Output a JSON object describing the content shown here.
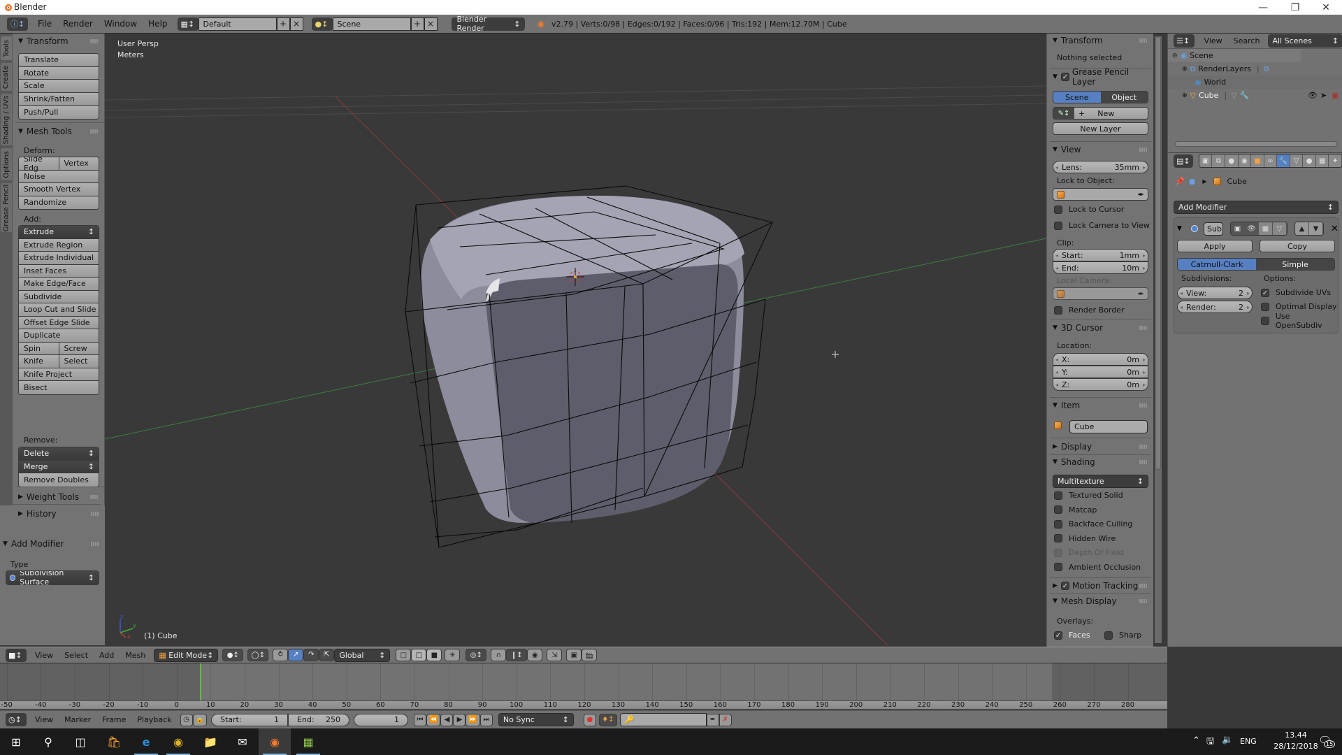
{
  "window": {
    "title": "Blender",
    "controls": [
      "minimize",
      "maximize",
      "close"
    ]
  },
  "info_header": {
    "menus": [
      "File",
      "Render",
      "Window",
      "Help"
    ],
    "screen_layout": "Default",
    "scene": "Scene",
    "render_engine": "Blender Render",
    "stats": "v2.79 | Verts:0/98 | Edges:0/192 | Faces:0/96 | Tris:192 | Mem:12.70M | Cube"
  },
  "tool_tabs": [
    "Tools",
    "Create",
    "Shading / UVs",
    "Options",
    "Grease Pencil"
  ],
  "toolshelf": {
    "transform": {
      "title": "Transform",
      "buttons": [
        "Translate",
        "Rotate",
        "Scale",
        "Shrink/Fatten",
        "Push/Pull"
      ]
    },
    "mesh_tools": {
      "title": "Mesh Tools",
      "deform_label": "Deform:",
      "deform_row": [
        "Slide Edg",
        "Vertex"
      ],
      "deform_buttons": [
        "Noise",
        "Smooth Vertex",
        "Randomize"
      ],
      "add_label": "Add:",
      "extrude_dropdown": "Extrude",
      "add_buttons": [
        "Extrude Region",
        "Extrude Individual",
        "Inset Faces",
        "Make Edge/Face",
        "Subdivide",
        "Loop Cut and Slide",
        "Offset Edge Slide",
        "Duplicate"
      ],
      "spin_row": [
        "Spin",
        "Screw"
      ],
      "knife_row": [
        "Knife",
        "Select"
      ],
      "add_buttons2": [
        "Knife Project",
        "Bisect"
      ],
      "remove_label": "Remove:",
      "delete_dropdown": "Delete",
      "merge_dropdown": "Merge",
      "remove_doubles": "Remove Doubles"
    },
    "weight_tools": "Weight Tools",
    "history": "History"
  },
  "operator_panel": {
    "title": "Add Modifier",
    "type_label": "Type",
    "type_value": "Subdivision Surface"
  },
  "viewport": {
    "view_name": "User Persp",
    "units": "Meters",
    "object_label": "(1) Cube",
    "axis_labels": [
      "z",
      "y",
      "x"
    ]
  },
  "npanel": {
    "transform": {
      "title": "Transform",
      "status": "Nothing selected"
    },
    "grease_pencil": {
      "title": "Grease Pencil Layer",
      "enabled": true,
      "toggle": [
        "Scene",
        "Object"
      ],
      "active_toggle": "Scene",
      "new_label": "New",
      "new_layer": "New Layer"
    },
    "view": {
      "title": "View",
      "lens_label": "Lens:",
      "lens_value": "35mm",
      "lock_object_label": "Lock to Object:",
      "lock_cursor": "Lock to Cursor",
      "lock_camera": "Lock Camera to View",
      "clip_label": "Clip:",
      "clip_start_label": "Start:",
      "clip_start": "1mm",
      "clip_end_label": "End:",
      "clip_end": "10m",
      "local_camera_label": "Local Camera:",
      "render_border": "Render Border"
    },
    "cursor": {
      "title": "3D Cursor",
      "location_label": "Location:",
      "x_label": "X:",
      "x": "0m",
      "y_label": "Y:",
      "y": "0m",
      "z_label": "Z:",
      "z": "0m"
    },
    "item": {
      "title": "Item",
      "name": "Cube"
    },
    "display": {
      "title": "Display"
    },
    "shading": {
      "title": "Shading",
      "mode": "Multitexture",
      "options": [
        {
          "label": "Textured Solid",
          "checked": false,
          "enabled": true
        },
        {
          "label": "Matcap",
          "checked": false,
          "enabled": true
        },
        {
          "label": "Backface Culling",
          "checked": false,
          "enabled": true
        },
        {
          "label": "Hidden Wire",
          "checked": false,
          "enabled": true
        },
        {
          "label": "Depth Of Field",
          "checked": false,
          "enabled": false
        },
        {
          "label": "Ambient Occlusion",
          "checked": false,
          "enabled": true
        }
      ]
    },
    "motion_tracking": {
      "title": "Motion Tracking",
      "enabled": true
    },
    "mesh_display": {
      "title": "Mesh Display",
      "overlays_label": "Overlays:",
      "faces": "Faces",
      "faces_checked": true,
      "sharp": "Sharp",
      "sharp_checked": false
    }
  },
  "outliner": {
    "menus": [
      "View",
      "Search"
    ],
    "filter": "All Scenes",
    "rows": [
      {
        "label": "Scene",
        "icon": "scene-icon",
        "depth": 0
      },
      {
        "label": "RenderLayers",
        "icon": "render-layers-icon",
        "depth": 1
      },
      {
        "label": "World",
        "icon": "world-icon",
        "depth": 1
      },
      {
        "label": "Cube",
        "icon": "mesh-object-icon",
        "depth": 1
      }
    ]
  },
  "properties": {
    "tabs": [
      "render",
      "render-layers",
      "scene",
      "world",
      "object",
      "constraints",
      "modifiers",
      "data",
      "material",
      "texture",
      "particles"
    ],
    "active_tab": "modifiers",
    "context_object": "Cube",
    "add_modifier": "Add Modifier",
    "modifier": {
      "name": "Sub",
      "apply": "Apply",
      "copy": "Copy",
      "algorithms": [
        "Catmull-Clark",
        "Simple"
      ],
      "active_algorithm": "Catmull-Clark",
      "subdivisions_label": "Subdivisions:",
      "view_label": "View:",
      "view_value": "2",
      "render_label": "Render:",
      "render_value": "2",
      "options_label": "Options:",
      "options": [
        {
          "label": "Subdivide UVs",
          "checked": true
        },
        {
          "label": "Optimal Display",
          "checked": false
        },
        {
          "label": "Use OpenSubdiv",
          "checked": false
        }
      ]
    }
  },
  "viewport_header": {
    "menus": [
      "View",
      "Select",
      "Add",
      "Mesh"
    ],
    "mode": "Edit Mode",
    "orientation": "Global"
  },
  "timeline": {
    "ticks": [
      -50,
      -40,
      -30,
      -20,
      -10,
      0,
      10,
      20,
      30,
      40,
      50,
      60,
      70,
      80,
      90,
      100,
      110,
      120,
      130,
      140,
      150,
      160,
      170,
      180,
      190,
      200,
      210,
      220,
      230,
      240,
      250,
      260,
      270,
      280
    ],
    "menus": [
      "View",
      "Marker",
      "Frame",
      "Playback"
    ],
    "start_label": "Start:",
    "start": "1",
    "end_label": "End:",
    "end": "250",
    "current_frame": "1",
    "sync": "No Sync"
  },
  "taskbar": {
    "apps": [
      "start",
      "search",
      "task-view",
      "store",
      "edge",
      "chrome",
      "file-explorer",
      "mail",
      "blender",
      "image-app"
    ],
    "language": "ENG",
    "time": "13.44",
    "date": "28/12/2018",
    "notifications": "15"
  }
}
